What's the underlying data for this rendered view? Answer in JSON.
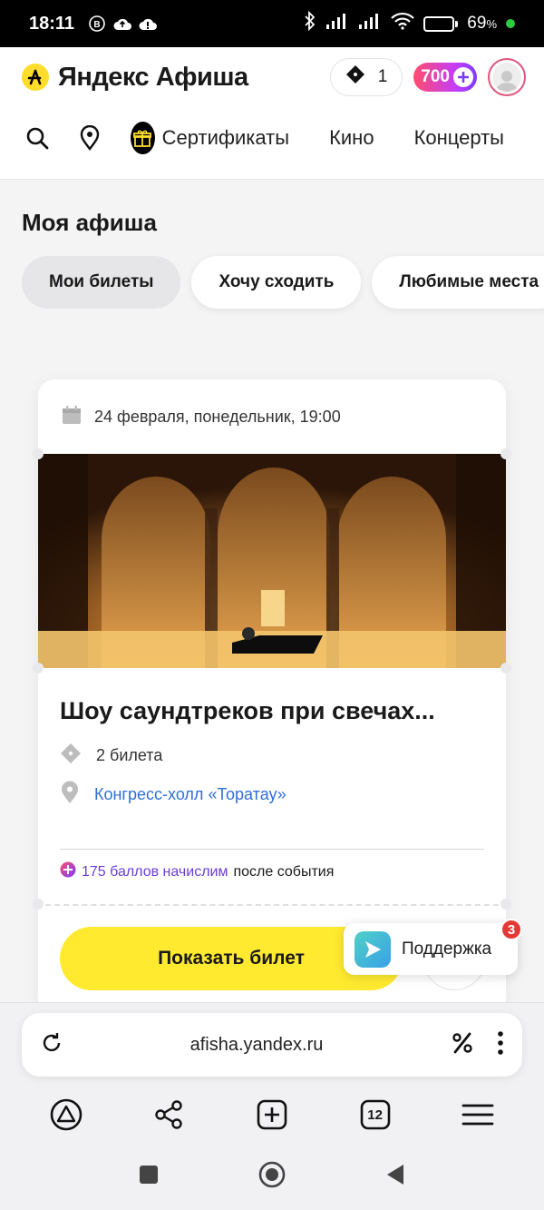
{
  "status_bar": {
    "time": "18:11",
    "battery_value": "69",
    "battery_unit": "%",
    "battery_level": 0.69
  },
  "header": {
    "brand": "Яндекс Афиша",
    "tickets_count": "1",
    "points": "700"
  },
  "nav": {
    "items": [
      "Сертификаты",
      "Кино",
      "Концерты"
    ]
  },
  "page_title": "Моя афиша",
  "tabs": [
    {
      "label": "Мои билеты",
      "active": true
    },
    {
      "label": "Хочу сходить",
      "active": false
    },
    {
      "label": "Любимые места",
      "active": false
    }
  ],
  "ticket_card": {
    "date": "24 февраля, понедельник, 19:00",
    "title": "Шоу саундтреков при свечах...",
    "tickets": "2 билета",
    "venue": "Конгресс-холл «Торатау»",
    "points_accent": "175 баллов начислим",
    "points_rest": "после события",
    "show_ticket_label": "Показать билет"
  },
  "support": {
    "label": "Поддержка",
    "badge": "3"
  },
  "browser": {
    "url": "afisha.yandex.ru",
    "tabs_count": "12"
  },
  "colors": {
    "accent_yellow": "#ffea30",
    "link_blue": "#2f6fd6",
    "points_purple": "#6a3fd6",
    "badge_red": "#e53935"
  }
}
